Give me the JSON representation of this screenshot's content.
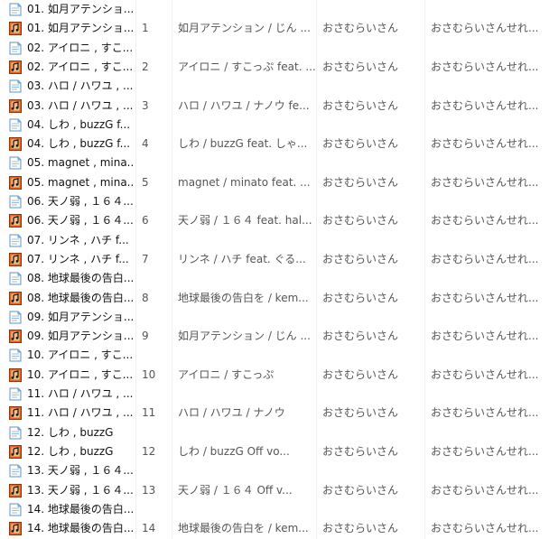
{
  "icons": {
    "text": "text-file-icon",
    "audio": "audio-file-icon"
  },
  "colors": {
    "accent_orange": "#e8621b",
    "text_blue": "#5b93c8",
    "text_gray": "#555555"
  },
  "rows": [
    {
      "type": "text",
      "name": "01. 如月アテンショ..."
    },
    {
      "type": "audio",
      "name": "01. 如月アテンショ...",
      "num": "1",
      "title": "如月アテンション / じん ...",
      "artist": "おさむらいさん",
      "album": "おさむらいさんせれ..."
    },
    {
      "type": "text",
      "name": "02. アイロニ , すこ..."
    },
    {
      "type": "audio",
      "name": "02. アイロニ , すこ...",
      "num": "2",
      "title": "アイロニ / すこっぷ feat. ...",
      "artist": "おさむらいさん",
      "album": "おさむらいさんせれ..."
    },
    {
      "type": "text",
      "name": "03. ハロ / ハワユ , ..."
    },
    {
      "type": "audio",
      "name": "03. ハロ / ハワユ , ...",
      "num": "3",
      "title": "ハロ / ハワユ / ナノウ fe...",
      "artist": "おさむらいさん",
      "album": "おさむらいさんせれ..."
    },
    {
      "type": "text",
      "name": "04. しわ , buzzG f..."
    },
    {
      "type": "audio",
      "name": "04. しわ , buzzG f...",
      "num": "4",
      "title": "しわ / buzzG feat. しゃ...",
      "artist": "おさむらいさん",
      "album": "おさむらいさんせれ..."
    },
    {
      "type": "text",
      "name": "05. magnet , mina..."
    },
    {
      "type": "audio",
      "name": "05. magnet , mina...",
      "num": "5",
      "title": "magnet / minato feat. ...",
      "artist": "おさむらいさん",
      "album": "おさむらいさんせれ..."
    },
    {
      "type": "text",
      "name": "06. 天ノ弱 , １６４..."
    },
    {
      "type": "audio",
      "name": "06. 天ノ弱 , １６４...",
      "num": "6",
      "title": "天ノ弱 / １６４ feat. hal...",
      "artist": "おさむらいさん",
      "album": "おさむらいさんせれ..."
    },
    {
      "type": "text",
      "name": "07. リンネ , ハチ f..."
    },
    {
      "type": "audio",
      "name": "07. リンネ , ハチ f...",
      "num": "7",
      "title": "リンネ / ハチ feat. ぐる...",
      "artist": "おさむらいさん",
      "album": "おさむらいさんせれ..."
    },
    {
      "type": "text",
      "name": "08. 地球最後の告白..."
    },
    {
      "type": "audio",
      "name": "08. 地球最後の告白...",
      "num": "8",
      "title": "地球最後の告白を / kem...",
      "artist": "おさむらいさん",
      "album": "おさむらいさんせれ..."
    },
    {
      "type": "text",
      "name": "09. 如月アテンショ..."
    },
    {
      "type": "audio",
      "name": "09. 如月アテンショ...",
      "num": "9",
      "title": "如月アテンション / じん ...",
      "artist": "おさむらいさん",
      "album": "おさむらいさんせれ..."
    },
    {
      "type": "text",
      "name": "10. アイロニ , すこ..."
    },
    {
      "type": "audio",
      "name": "10. アイロニ , すこ...",
      "num": "10",
      "title": "アイロニ / すこっぷ",
      "artist": "おさむらいさん",
      "album": "おさむらいさんせれ..."
    },
    {
      "type": "text",
      "name": "11. ハロ / ハワユ , ..."
    },
    {
      "type": "audio",
      "name": "11. ハロ / ハワユ , ...",
      "num": "11",
      "title": "ハロ / ハワユ / ナノウ",
      "artist": "おさむらいさん",
      "album": "おさむらいさんせれ..."
    },
    {
      "type": "text",
      "name": "12. しわ , buzzG"
    },
    {
      "type": "audio",
      "name": "12. しわ , buzzG",
      "num": "12",
      "title": "しわ / buzzG      Off vo...",
      "artist": "おさむらいさん",
      "album": "おさむらいさんせれ..."
    },
    {
      "type": "text",
      "name": "13. 天ノ弱 , １６４..."
    },
    {
      "type": "audio",
      "name": "13. 天ノ弱 , １６４...",
      "num": "13",
      "title": "天ノ弱 / １６４      Off v...",
      "artist": "おさむらいさん",
      "album": "おさむらいさんせれ..."
    },
    {
      "type": "text",
      "name": "14. 地球最後の告白..."
    },
    {
      "type": "audio",
      "name": "14. 地球最後の告白...",
      "num": "14",
      "title": "地球最後の告白を / kem...",
      "artist": "おさむらいさん",
      "album": "おさむらいさんせれ..."
    }
  ]
}
